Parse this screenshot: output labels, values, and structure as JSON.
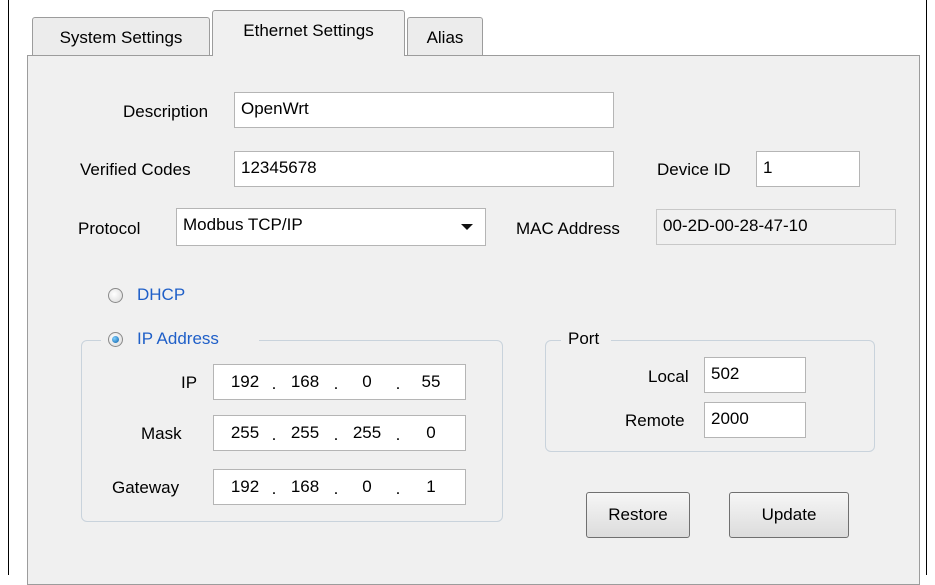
{
  "tabs": [
    {
      "label": "System Settings",
      "active": false
    },
    {
      "label": "Ethernet Settings",
      "active": true
    },
    {
      "label": "Alias",
      "active": false
    }
  ],
  "fields": {
    "description": {
      "label": "Description",
      "value": "OpenWrt"
    },
    "verified_codes": {
      "label": "Verified Codes",
      "value": "12345678"
    },
    "device_id": {
      "label": "Device ID",
      "value": "1"
    },
    "protocol": {
      "label": "Protocol",
      "value": "Modbus TCP/IP"
    },
    "mac_address": {
      "label": "MAC Address",
      "value": "00-2D-00-28-47-10"
    }
  },
  "addressing": {
    "dhcp_label": "DHCP",
    "ip_address_label": "IP Address",
    "selected": "IP Address",
    "ip": {
      "label": "IP",
      "octets": [
        "192",
        "168",
        "0",
        "55"
      ]
    },
    "mask": {
      "label": "Mask",
      "octets": [
        "255",
        "255",
        "255",
        "0"
      ]
    },
    "gateway": {
      "label": "Gateway",
      "octets": [
        "192",
        "168",
        "0",
        "1"
      ]
    },
    "octet_separator": "."
  },
  "port": {
    "title": "Port",
    "local": {
      "label": "Local",
      "value": "502"
    },
    "remote": {
      "label": "Remote",
      "value": "2000"
    }
  },
  "buttons": {
    "restore": "Restore",
    "update": "Update"
  },
  "colors": {
    "link_blue": "#1f5fc8",
    "radio_selected": "#0a5ea8"
  }
}
